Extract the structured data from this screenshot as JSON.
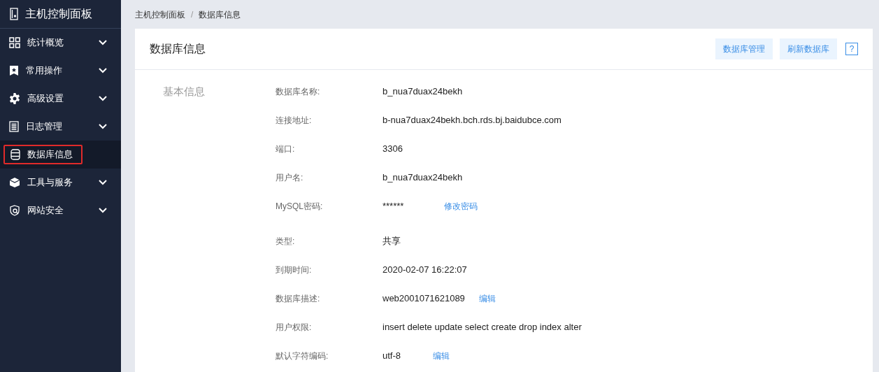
{
  "sidebar": {
    "title": "主机控制面板",
    "items": [
      {
        "label": "统计概览",
        "kind": "grid",
        "expandable": true,
        "selected": false
      },
      {
        "label": "常用操作",
        "kind": "bookmark",
        "expandable": true,
        "selected": false
      },
      {
        "label": "高级设置",
        "kind": "gear",
        "expandable": true,
        "selected": false
      },
      {
        "label": "日志管理",
        "kind": "list",
        "expandable": true,
        "selected": false
      },
      {
        "label": "数据库信息",
        "kind": "database",
        "expandable": false,
        "selected": true
      },
      {
        "label": "工具与服务",
        "kind": "box",
        "expandable": true,
        "selected": false
      },
      {
        "label": "网站安全",
        "kind": "shield",
        "expandable": true,
        "selected": false
      }
    ]
  },
  "breadcrumb": [
    "主机控制面板",
    "/",
    "数据库信息"
  ],
  "card": {
    "title": "数据库信息",
    "buttons": [
      "数据库管理",
      "刷新数据库"
    ],
    "help": "?",
    "section": "基本信息",
    "rows": [
      {
        "label": "数据库名称:",
        "value": "b_nua7duax24bekh"
      },
      {
        "label": "连接地址:",
        "value": "b-nua7duax24bekh.bch.rds.bj.baidubce.com"
      },
      {
        "label": "端口:",
        "value": "3306"
      },
      {
        "label": "用户名:",
        "value": "b_nua7duax24bekh"
      },
      {
        "label": "MySQL密码:",
        "value": "******",
        "link": "修改密码"
      },
      {
        "label": "类型:",
        "value": "共享"
      },
      {
        "label": "到期时间:",
        "value": "2020-02-07 16:22:07"
      },
      {
        "label": "数据库描述:",
        "value": "web2001071621089",
        "link": "编辑"
      },
      {
        "label": "用户权限:",
        "value": "insert delete update select create drop index alter"
      },
      {
        "label": "默认字符编码:",
        "value": "utf-8",
        "link": "编辑"
      }
    ]
  }
}
